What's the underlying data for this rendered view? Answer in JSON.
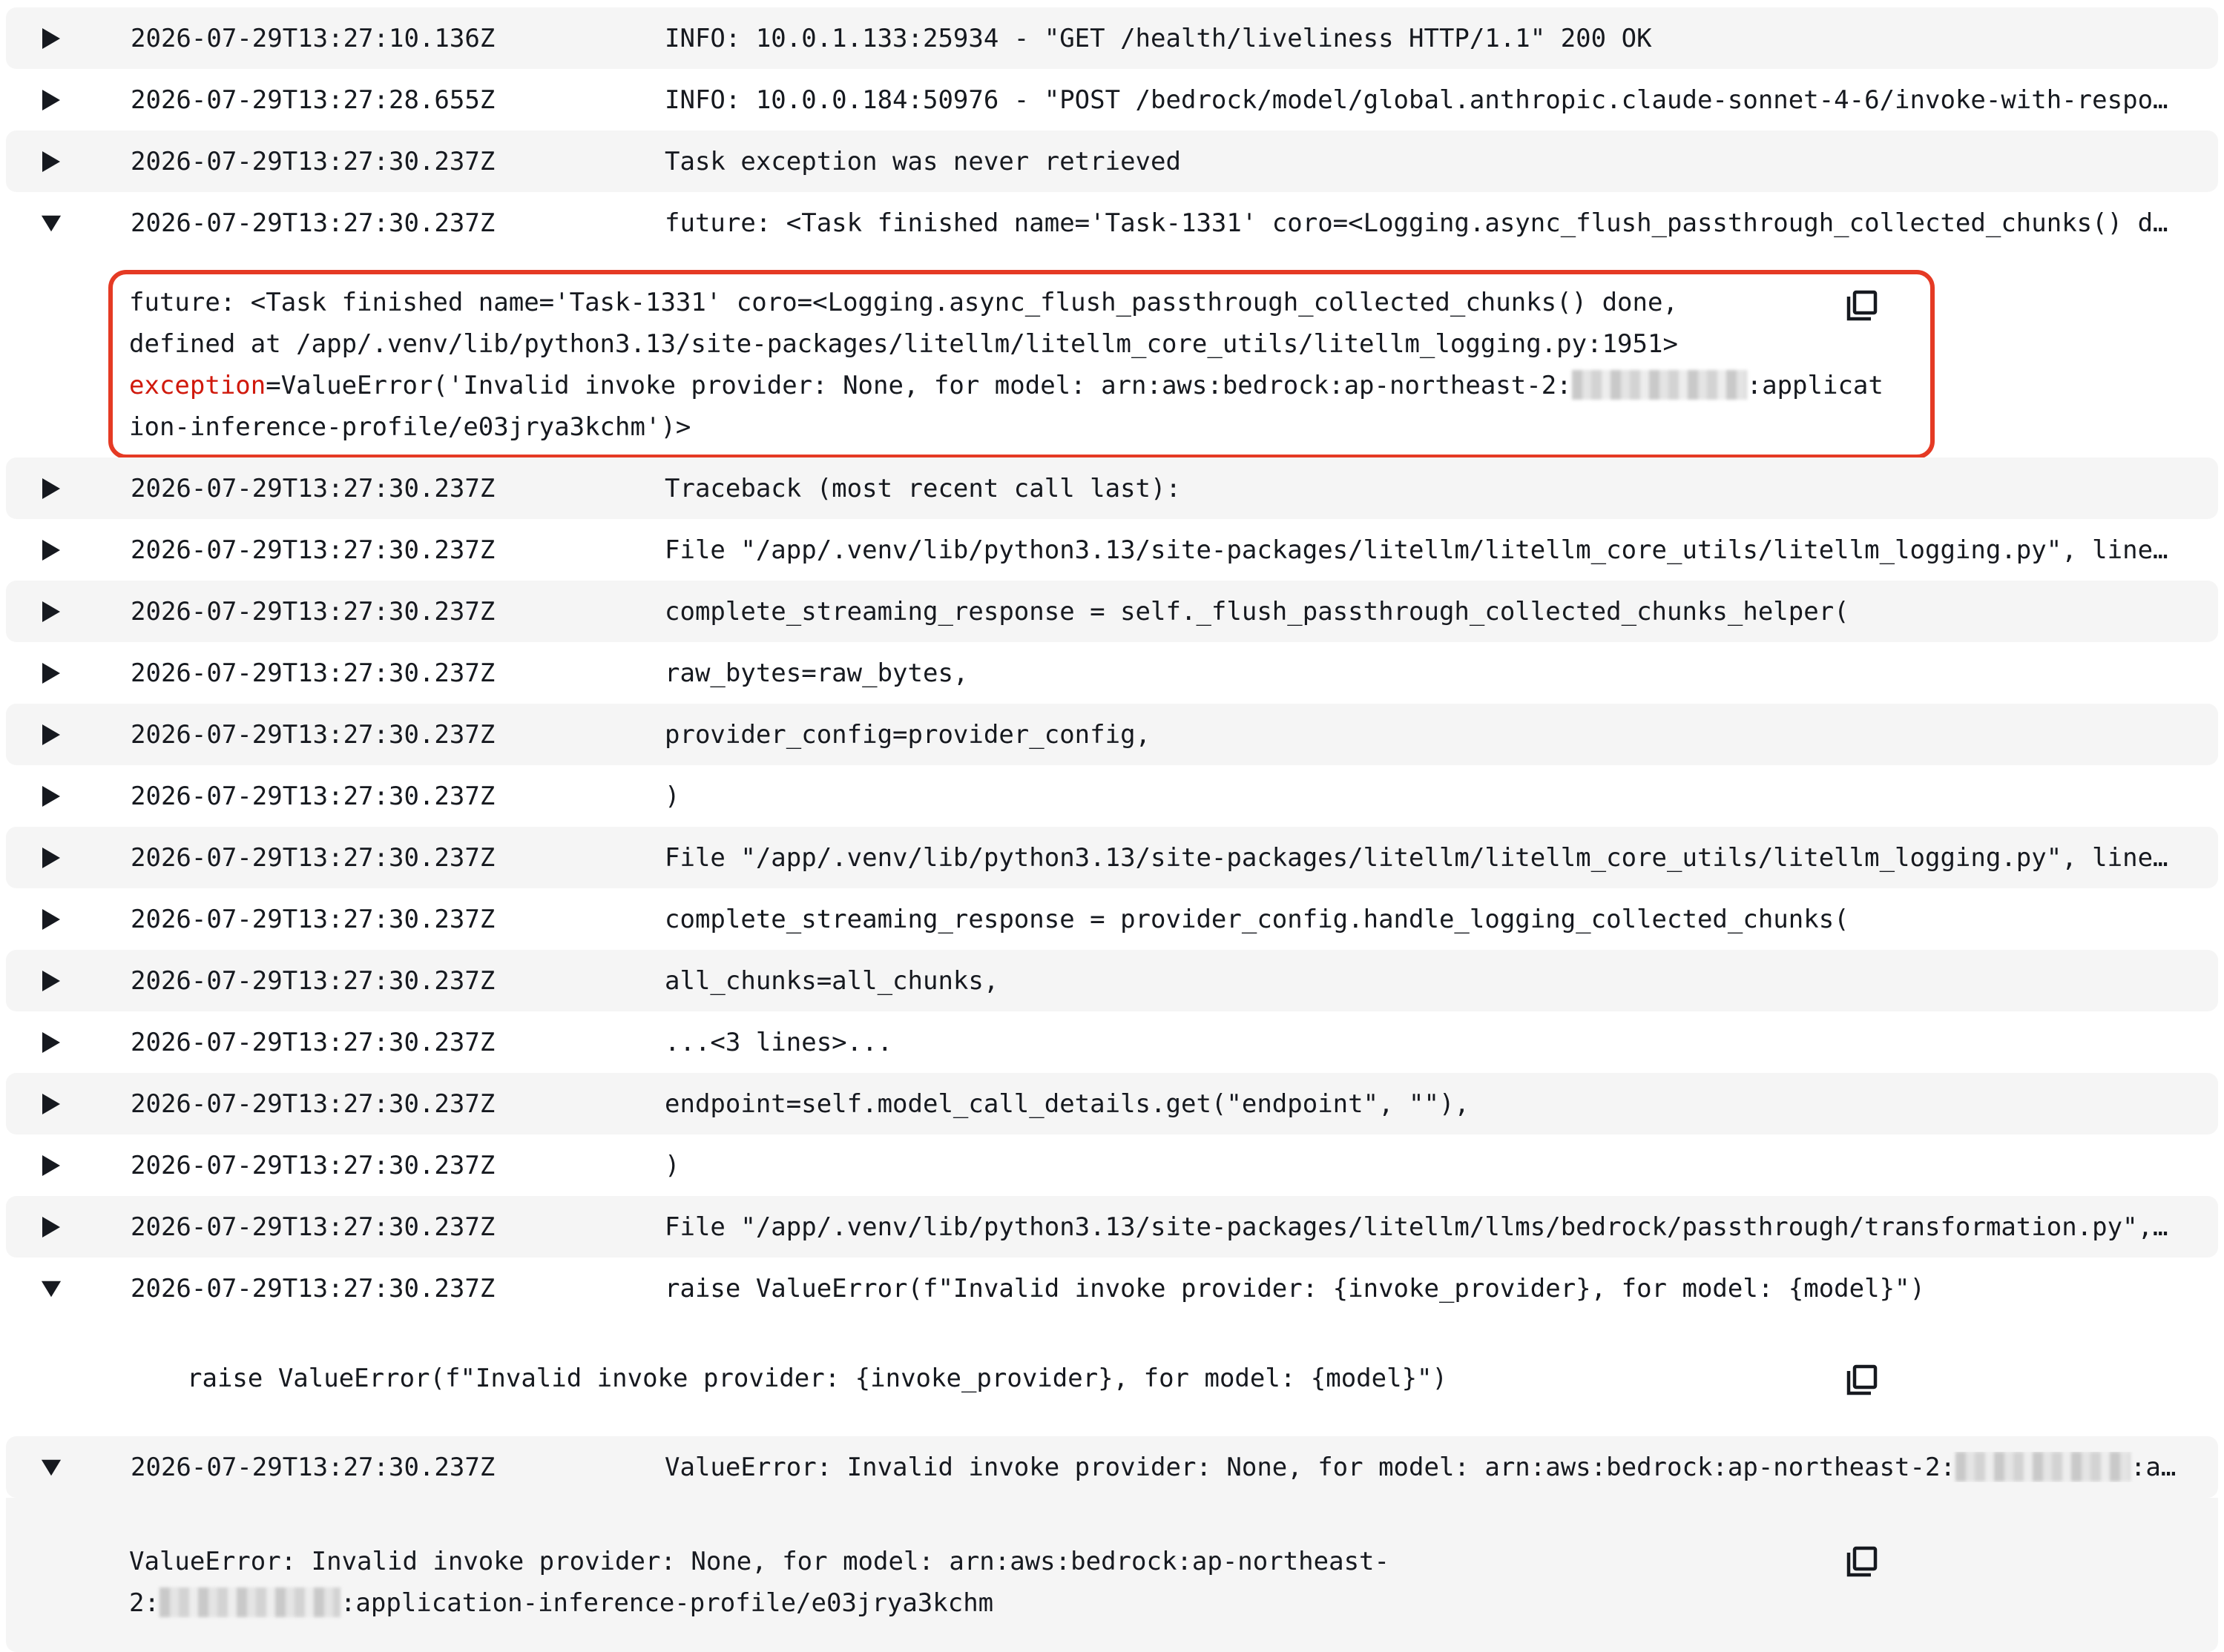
{
  "icons": {
    "expanded": "caret-down-icon",
    "collapsed": "caret-right-icon",
    "copy": "copy-icon"
  },
  "colors": {
    "highlight_border": "#e53a24",
    "exception_keyword": "#d0190c",
    "row_stripe": "#f5f5f5"
  },
  "rows": [
    {
      "ts": "2026-07-29T13:27:10.136Z",
      "msg": "INFO: 10.0.1.133:25934 - \"GET /health/liveliness HTTP/1.1\" 200 OK"
    },
    {
      "ts": "2026-07-29T13:27:28.655Z",
      "msg": "INFO: 10.0.0.184:50976 - \"POST /bedrock/model/global.anthropic.claude-sonnet-4-6/invoke-with-response…"
    },
    {
      "ts": "2026-07-29T13:27:30.237Z",
      "msg": "Task exception was never retrieved"
    },
    {
      "ts": "2026-07-29T13:27:30.237Z",
      "msg": "future: <Task finished name='Task-1331' coro=<Logging.async_flush_passthrough_collected_chunks() done…",
      "expanded": true
    },
    {
      "ts": "2026-07-29T13:27:30.237Z",
      "msg": "Traceback (most recent call last):"
    },
    {
      "ts": "2026-07-29T13:27:30.237Z",
      "msg": "File \"/app/.venv/lib/python3.13/site-packages/litellm/litellm_core_utils/litellm_logging.py\", line 19…"
    },
    {
      "ts": "2026-07-29T13:27:30.237Z",
      "msg": "complete_streaming_response = self._flush_passthrough_collected_chunks_helper("
    },
    {
      "ts": "2026-07-29T13:27:30.237Z",
      "msg": "raw_bytes=raw_bytes,"
    },
    {
      "ts": "2026-07-29T13:27:30.237Z",
      "msg": "provider_config=provider_config,"
    },
    {
      "ts": "2026-07-29T13:27:30.237Z",
      "msg": ")"
    },
    {
      "ts": "2026-07-29T13:27:30.237Z",
      "msg": "File \"/app/.venv/lib/python3.13/site-packages/litellm/litellm_core_utils/litellm_logging.py\", line 19…"
    },
    {
      "ts": "2026-07-29T13:27:30.237Z",
      "msg": "complete_streaming_response = provider_config.handle_logging_collected_chunks("
    },
    {
      "ts": "2026-07-29T13:27:30.237Z",
      "msg": "all_chunks=all_chunks,"
    },
    {
      "ts": "2026-07-29T13:27:30.237Z",
      "msg": "...<3 lines>..."
    },
    {
      "ts": "2026-07-29T13:27:30.237Z",
      "msg": "endpoint=self.model_call_details.get(\"endpoint\", \"\"),"
    },
    {
      "ts": "2026-07-29T13:27:30.237Z",
      "msg": ")"
    },
    {
      "ts": "2026-07-29T13:27:30.237Z",
      "msg": "File \"/app/.venv/lib/python3.13/site-packages/litellm/llms/bedrock/passthrough/transformation.py\", li…"
    },
    {
      "ts": "2026-07-29T13:27:30.237Z",
      "msg": "raise ValueError(f\"Invalid invoke provider: {invoke_provider}, for model: {model}\")",
      "expanded": true
    },
    {
      "ts": "2026-07-29T13:27:30.237Z",
      "msg": "ValueError: Invalid invoke provider: None, for model: arn:aws:bedrock:ap-northeast-2:",
      "msg_tail": ":app…",
      "redacted": true,
      "expanded": true
    }
  ],
  "details": {
    "future": {
      "line1": "future: <Task finished name='Task-1331' coro=<Logging.async_flush_passthrough_collected_chunks() done,",
      "line2": "defined at /app/.venv/lib/python3.13/site-packages/litellm/litellm_core_utils/litellm_logging.py:1951>",
      "exception_keyword": "exception",
      "line3_rest": "=ValueError('Invalid invoke provider: None, for model: arn:aws:bedrock:ap-northeast-2:",
      "line3_after_redaction": ":application-inference-profile/e03jrya3kchm')>"
    },
    "raise": {
      "text": "raise ValueError(f\"Invalid invoke provider: {invoke_provider}, for model: {model}\")"
    },
    "valueerror": {
      "line1": "ValueError: Invalid invoke provider: None, for model: arn:aws:bedrock:ap-northeast-",
      "line2_prefix": "2:",
      "line2_suffix": ":application-inference-profile/e03jrya3kchm"
    }
  }
}
